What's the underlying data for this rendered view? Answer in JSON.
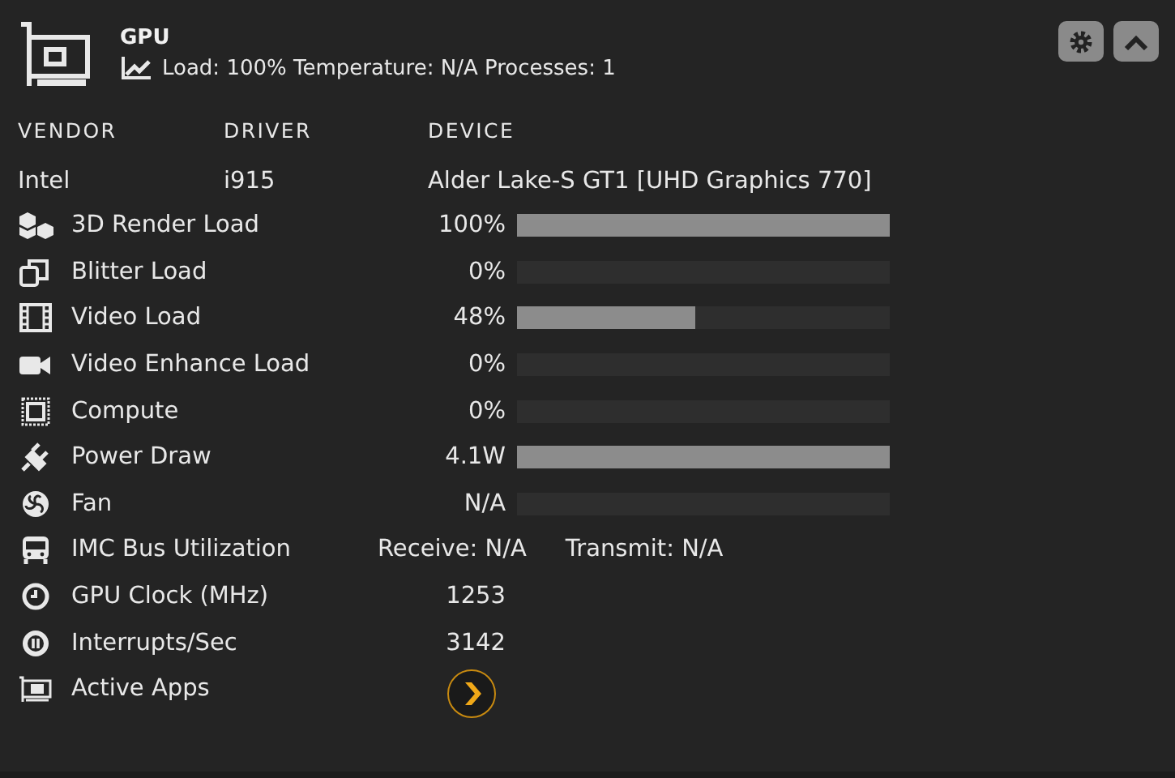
{
  "header": {
    "title": "GPU",
    "summary": "Load: 100% Temperature: N/A Processes: 1"
  },
  "info": {
    "columns": [
      "VENDOR",
      "DRIVER",
      "DEVICE"
    ],
    "values": [
      "Intel",
      "i915",
      "Alder Lake-S GT1 [UHD Graphics 770]"
    ]
  },
  "rows": [
    {
      "kind": "bar",
      "label": "3D Render Load",
      "value": "100%",
      "level": 1
    },
    {
      "kind": "bar",
      "label": "Blitter Load",
      "value": "0%",
      "level": 0
    },
    {
      "kind": "bar",
      "label": "Video Load",
      "value": "48%",
      "level": 0.48
    },
    {
      "kind": "bar",
      "label": "Video Enhance Load",
      "value": "0%",
      "level": 0
    },
    {
      "kind": "bar",
      "label": "Compute",
      "value": "0%",
      "level": 0
    },
    {
      "kind": "bar",
      "label": "Power Draw",
      "value": "4.1W",
      "level": 1
    },
    {
      "kind": "bar",
      "label": "Fan",
      "value": "N/A",
      "level": 0
    },
    {
      "kind": "pair",
      "label": "IMC Bus Utilization",
      "value": "Receive: N/A",
      "value_2": "Transmit: N/A"
    },
    {
      "kind": "text",
      "label": "GPU Clock (MHz)",
      "value": "1253"
    },
    {
      "kind": "text",
      "label": "Interrupts/Sec",
      "value": "3142"
    },
    {
      "kind": "button",
      "label": "Active Apps"
    }
  ]
}
